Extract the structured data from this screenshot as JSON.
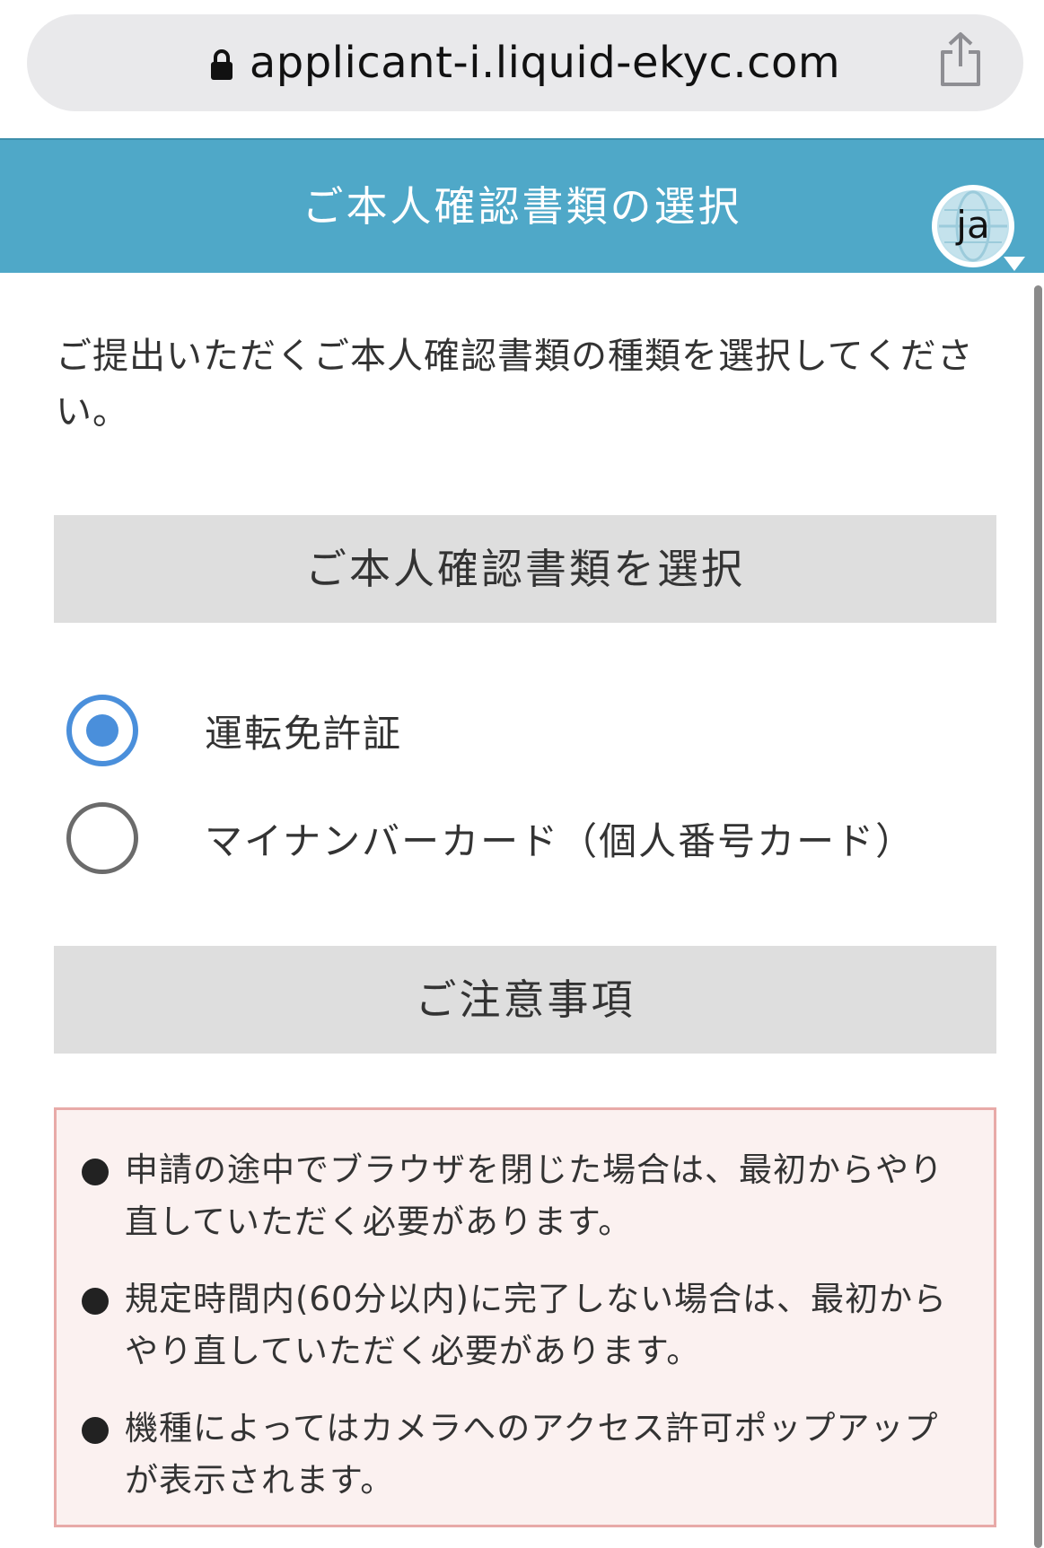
{
  "browser": {
    "url": "applicant-i.liquid-ekyc.com",
    "lock_icon": "lock-icon",
    "share_icon": "share-icon"
  },
  "header": {
    "title": "ご本人確認書類の選択",
    "language_code": "ja",
    "language_icon": "globe-icon",
    "background_color": "#4fa8c8"
  },
  "main": {
    "intro_text": "ご提出いただくご本人確認書類の種類を選択してください。",
    "document_section": {
      "title": "ご本人確認書類を選択",
      "options": [
        {
          "label": "運転免許証",
          "selected": true
        },
        {
          "label": "マイナンバーカード（個人番号カード）",
          "selected": false
        }
      ]
    },
    "notes_section": {
      "title": "ご注意事項",
      "items": [
        "申請の途中でブラウザを閉じた場合は、最初からやり直していただく必要があります。",
        "規定時間内(60分以内)に完了しない場合は、最初からやり直していただく必要があります。",
        "機種によってはカメラへのアクセス許可ポップアップが表示されます。"
      ]
    }
  },
  "colors": {
    "accent": "#4a8fdb",
    "section_bar": "#dedede",
    "notes_background": "#fbf1f0",
    "notes_border": "#e8aaa8"
  }
}
